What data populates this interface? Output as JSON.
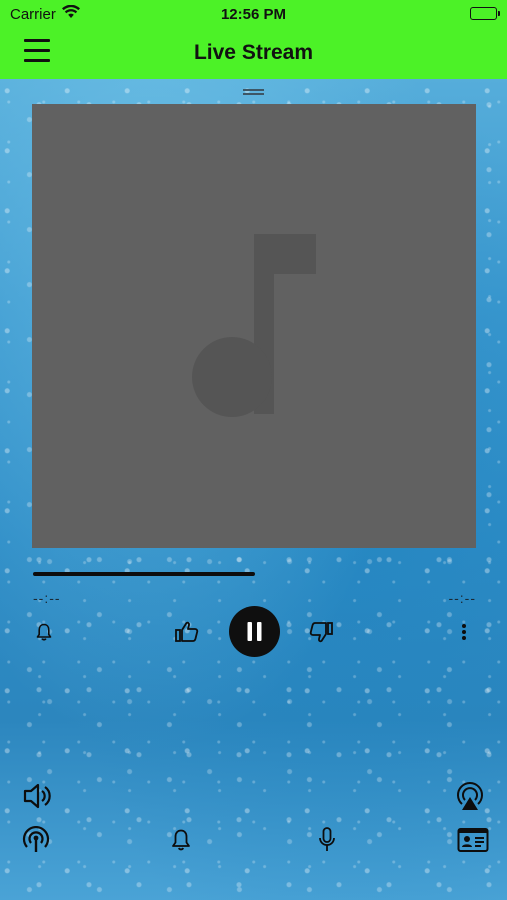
{
  "status_bar": {
    "carrier": "Carrier",
    "time": "12:56 PM",
    "icons": [
      "wifi-icon",
      "battery-icon"
    ]
  },
  "nav": {
    "title": "Live Stream",
    "menu_icon": "hamburger-menu-icon"
  },
  "player": {
    "artwork_icon": "music-note-icon",
    "progress": 0.5,
    "time_elapsed": "--:--",
    "time_remaining": "--:--",
    "controls": [
      "bell-icon",
      "thumbs-up-icon",
      "pause-icon",
      "thumbs-down-icon",
      "more-vertical-icon"
    ]
  },
  "bottom_bar": {
    "icons": [
      "volume-icon",
      "airplay-icon",
      "broadcast-icon",
      "bell-icon",
      "microphone-icon",
      "contact-card-icon"
    ]
  },
  "colors": {
    "header": "#4cf227",
    "artwork_bg": "#616161",
    "artwork_icon": "#555555",
    "icon": "#0d0d0d"
  }
}
